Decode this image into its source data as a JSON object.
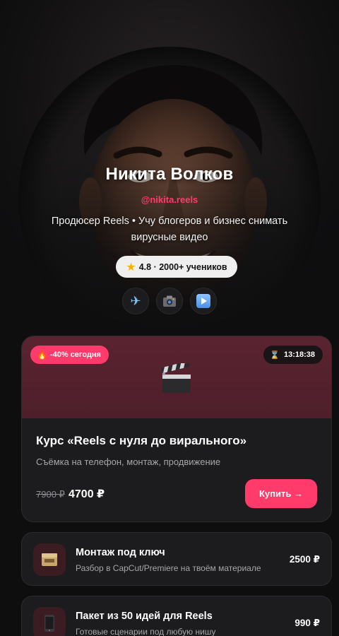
{
  "profile": {
    "name": "Никита Волков",
    "handle": "@nikita.reels",
    "bio": "Продюсер Reels • Учу блогеров и бизнес снимать вирусные видео",
    "rating": "4.8 · 2000+ учеников"
  },
  "socials": [
    {
      "name": "telegram",
      "icon": "airplane-icon"
    },
    {
      "name": "instagram",
      "icon": "camera-icon"
    },
    {
      "name": "youtube",
      "icon": "play-icon"
    }
  ],
  "featured": {
    "discount_badge": "-40% сегодня",
    "timer": "13:18:38",
    "title": "Курс «Reels с нуля до вирального»",
    "subtitle": "Съёмка на телефон, монтаж, продвижение",
    "old_price": "7900 ₽",
    "new_price": "4700 ₽",
    "buy_label": "Купить →",
    "icon": "clapperboard-icon",
    "accent_color": "#ff3b6b"
  },
  "services": [
    {
      "title": "Монтаж под ключ",
      "description": "Разбор в CapCut/Premiere на твоём материале",
      "price": "2500 ₽",
      "icon": "film-box-icon"
    },
    {
      "title": "Пакет из 50 идей для Reels",
      "description": "Готовые сценарии под любую нишу",
      "price": "990 ₽",
      "icon": "phone-icon"
    }
  ]
}
